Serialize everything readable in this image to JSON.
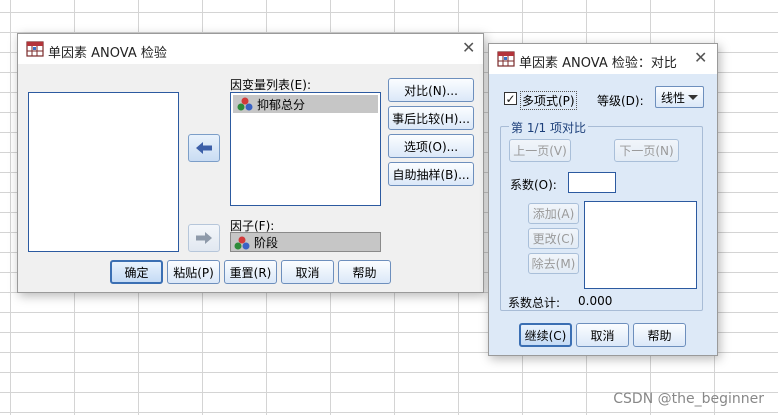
{
  "dialog1": {
    "title": "单因素 ANOVA 检验",
    "dependent_list_label": "因变量列表(E):",
    "dependent_items": [
      "抑郁总分"
    ],
    "factor_label": "因子(F):",
    "factor_value": "阶段",
    "side_buttons": [
      "对比(N)...",
      "事后比较(H)...",
      "选项(O)...",
      "自助抽样(B)..."
    ],
    "bottom_buttons": [
      "确定",
      "粘贴(P)",
      "重置(R)",
      "取消",
      "帮助"
    ]
  },
  "dialog2": {
    "title": "单因素 ANOVA 检验：对比",
    "polynomial_label": "多项式(P)",
    "polynomial_checked": true,
    "degree_label": "等级(D):",
    "degree_value": "线性",
    "group_title": "第 1/1 项对比",
    "prev_label": "上一页(V)",
    "next_label": "下一页(N)",
    "coeff_label": "系数(O):",
    "coeff_value": "",
    "add_label": "添加(A)",
    "change_label": "更改(C)",
    "remove_label": "除去(M)",
    "coeff_total_label": "系数总计:",
    "coeff_total_value": "0.000",
    "continue_label": "继续(C)",
    "cancel_label": "取消",
    "help_label": "帮助"
  },
  "watermark": "CSDN @the_beginner",
  "colors": {
    "accent": "#2c5aa0",
    "dialog_bg": "#f0f0f0",
    "contrast_bg": "#dde9f7",
    "selection": "#c6c6c6"
  },
  "icons": {
    "app": "spss-table-icon",
    "variable": "nominal-variable-icon",
    "move_left": "arrow-left-icon",
    "move_right": "arrow-right-icon",
    "close": "close-icon"
  }
}
